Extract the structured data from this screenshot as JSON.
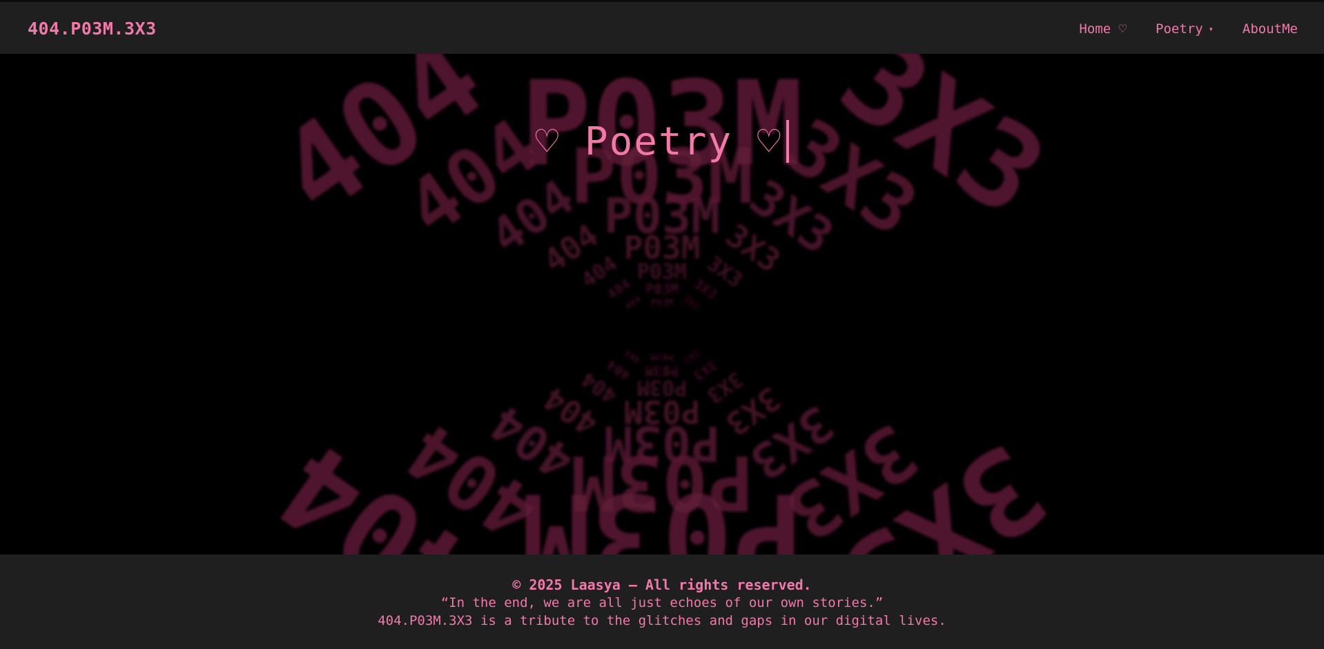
{
  "colors": {
    "accent": "#f07aa8",
    "header_bg": "#1f1f1f",
    "page_bg": "#000000",
    "tunnel_text": "#5e1a35"
  },
  "header": {
    "brand": "404.P03M.3X3",
    "nav": [
      {
        "label": "Home ♡",
        "icon": ""
      },
      {
        "label": "Poetry",
        "icon": "dropdown-caret-icon"
      },
      {
        "label": "AboutMe",
        "icon": ""
      }
    ]
  },
  "hero": {
    "title": "♡ Poetry ♡",
    "tunnel_words": [
      "404",
      "P03M",
      "3X3"
    ]
  },
  "footer": {
    "copyright": "© 2025 Laasya — All rights reserved.",
    "quote": "“In the end, we are all just echoes of our own stories.”",
    "tribute": "404.P03M.3X3 is a tribute to the glitches and gaps in our digital lives."
  }
}
